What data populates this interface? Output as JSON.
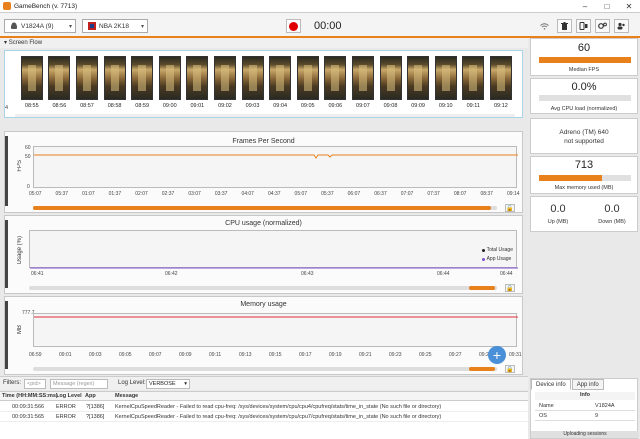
{
  "window": {
    "title": "GameBench (v. 7713)"
  },
  "toolbar": {
    "device": "V1824A (9)",
    "app": "NBA 2K18",
    "timer": "00:00"
  },
  "screen_flow": {
    "title": "Screen Flow",
    "first_label": "4",
    "labels": [
      "08:55",
      "08:56",
      "08:57",
      "08:58",
      "08:59",
      "09:00",
      "09:01",
      "09:02",
      "09:03",
      "09:04",
      "09:05",
      "09:06",
      "09:07",
      "09:08",
      "09:09",
      "09:10",
      "09:11",
      "09:12"
    ]
  },
  "fps_chart": {
    "title": "Frames Per Second",
    "ylabel": "FPS",
    "yticks": [
      "60",
      "50",
      "0"
    ],
    "xticks": [
      "05:07",
      "05:37",
      "01:07",
      "01:37",
      "02:07",
      "02:37",
      "03:07",
      "03:37",
      "04:07",
      "04:37",
      "05:07",
      "05:37",
      "06:07",
      "06:37",
      "07:07",
      "07:37",
      "08:07",
      "08:37",
      "09:14"
    ]
  },
  "cpu_chart": {
    "title": "CPU usage (normalized)",
    "ylabel": "Usage (%)",
    "xticks": [
      "06:41",
      "06:42",
      "06:43",
      "06:44",
      "06:44"
    ],
    "legend": [
      {
        "name": "Total Usage",
        "color": "#222222"
      },
      {
        "name": "App Usage",
        "color": "#7b4fc8"
      }
    ]
  },
  "mem_chart": {
    "title": "Memory usage",
    "ylabel": "MB",
    "ytick_top": "777.7",
    "xticks": [
      "06:59",
      "09:01",
      "09:03",
      "09:05",
      "09:07",
      "09:09",
      "09:11",
      "09:13",
      "09:15",
      "09:17",
      "09:19",
      "09:21",
      "09:23",
      "09:25",
      "09:27",
      "09:29",
      "09:31"
    ]
  },
  "stats": {
    "median_fps": {
      "value": "60",
      "label": "Median FPS",
      "fill": 1.0
    },
    "cpu": {
      "value": "0.0%",
      "label": "Avg CPU load (normalized)",
      "fill": 0.0
    },
    "gpu": {
      "line1": "Adreno (TM) 640",
      "line2": "not supported"
    },
    "memory": {
      "value": "713",
      "label": "Max memory used (MB)",
      "fill": 0.68
    },
    "up": {
      "value": "0.0",
      "label": "Up (MB)"
    },
    "down": {
      "value": "0.0",
      "label": "Down (MB)"
    }
  },
  "filters": {
    "label": "Filters:",
    "pid_placeholder": "<pid>",
    "message_placeholder": "Message (regex)",
    "log_level_label": "Log Level:",
    "log_level": "VERBOSE"
  },
  "log": {
    "headers": [
      "Time (HH:MM:SS:ms)",
      "Log Level",
      "App",
      "Message"
    ],
    "rows": [
      {
        "time": "00:09:31:566",
        "level": "ERROR",
        "app": "?[1386]",
        "message": "KernelCpuSpeedReader - Failed to read cpu-freq: /sys/devices/system/cpu/cpu4/cpufreq/stats/time_in_state (No such file or directory)"
      },
      {
        "time": "00:09:31:565",
        "level": "ERROR",
        "app": "?[1386]",
        "message": "KernelCpuSpeedReader - Failed to read cpu-freq: /sys/devices/system/cpu/cpu7/cpufreq/stats/time_in_state (No such file or directory)"
      }
    ]
  },
  "device_info": {
    "tabs": [
      "Device info",
      "App info"
    ],
    "header": "Info",
    "rows": [
      {
        "k": "Name",
        "v": "V1824A"
      },
      {
        "k": "OS",
        "v": "9"
      }
    ],
    "uploading": "Uploading sessions"
  },
  "colors": {
    "accent": "#e8801c",
    "record": "#e00000",
    "memory_line": "#e0303a"
  }
}
